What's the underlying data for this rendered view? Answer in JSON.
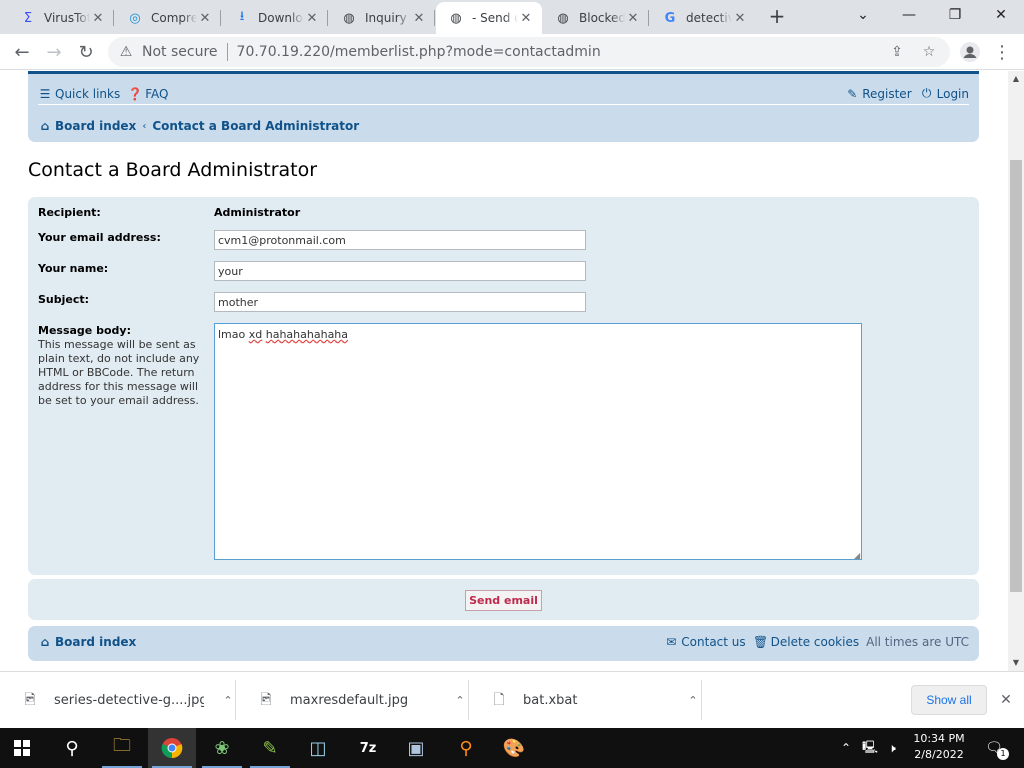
{
  "browser": {
    "tabs": [
      {
        "title": "VirusTotal",
        "icon": "virustotal-icon",
        "glyph": "Σ",
        "color": "#394eff",
        "active": false
      },
      {
        "title": "Compress",
        "icon": "compress-icon",
        "glyph": "◎",
        "color": "#1a8fd6",
        "active": false
      },
      {
        "title": "Downloads",
        "icon": "download-icon",
        "glyph": "⭳",
        "color": "#1a73e8",
        "active": false
      },
      {
        "title": "Inquiry",
        "icon": "globe-icon",
        "glyph": "◍",
        "color": "#5f6368",
        "active": false
      },
      {
        "title": " - Send e",
        "icon": "globe-icon",
        "glyph": "◍",
        "color": "#5f6368",
        "active": true
      },
      {
        "title": "Blocked",
        "icon": "globe-icon",
        "glyph": "◍",
        "color": "#5f6368",
        "active": false
      },
      {
        "title": "detective",
        "icon": "google-icon",
        "glyph": "G",
        "color": "#4285f4",
        "active": false
      }
    ],
    "security_label": "Not secure",
    "url": "70.70.19.220/memberlist.php?mode=contactadmin"
  },
  "forum": {
    "quick_links": "Quick links",
    "faq": "FAQ",
    "register": "Register",
    "login": "Login",
    "breadcrumb_home": "Board index",
    "breadcrumb_current": "Contact a Board Administrator",
    "page_title": "Contact a Board Administrator"
  },
  "form": {
    "recipient_label": "Recipient:",
    "recipient_value": "Administrator",
    "email_label": "Your email address:",
    "email_value": "cvm1@protonmail.com",
    "name_label": "Your name:",
    "name_value": "your",
    "subject_label": "Subject:",
    "subject_value": "mother",
    "message_label": "Message body:",
    "message_explain": "This message will be sent as plain text, do not include any HTML or BBCode. The return address for this message will be set to your email address.",
    "message_words": [
      "lmao",
      "xd",
      "hahahahahaha"
    ],
    "send_label": "Send email"
  },
  "footer": {
    "board_index": "Board index",
    "contact": "Contact us",
    "delete_cookies": "Delete cookies",
    "timezone": "All times are UTC"
  },
  "downloads": {
    "items": [
      {
        "name": "series-detective-g....jpg",
        "icon": "image-file-icon"
      },
      {
        "name": "maxresdefault.jpg",
        "icon": "image-file-icon"
      },
      {
        "name": "bat.xbat",
        "icon": "file-icon"
      }
    ],
    "show_all": "Show all"
  },
  "taskbar": {
    "time": "10:34 PM",
    "date": "2/8/2022",
    "notification_count": "1"
  },
  "colors": {
    "forum_link": "#105289",
    "forum_header_bg": "#cadceb",
    "form_panel_bg": "#e1ebf2",
    "send_button_text": "#bc2a4d"
  }
}
